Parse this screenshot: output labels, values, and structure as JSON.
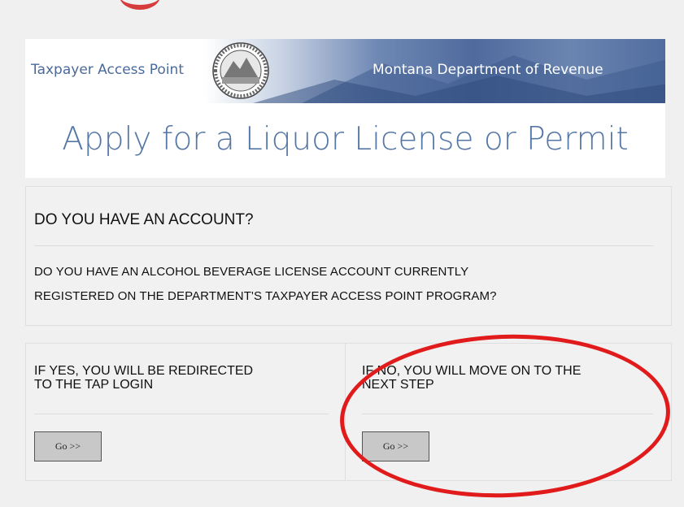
{
  "header": {
    "banner_left": "Taxpayer Access Point",
    "banner_right": "Montana Department of Revenue",
    "title": "Apply for a Liquor License or Permit"
  },
  "question": {
    "heading": "DO YOU HAVE AN ACCOUNT?",
    "line1": "DO YOU HAVE AN ALCOHOL BEVERAGE LICENSE ACCOUNT CURRENTLY",
    "line2": "REGISTERED ON THE DEPARTMENT'S TAXPAYER ACCESS POINT PROGRAM?"
  },
  "yes_option": {
    "line1": "IF YES, YOU WILL BE REDIRECTED",
    "line2": "TO THE TAP LOGIN",
    "button": "Go >>"
  },
  "no_option": {
    "line1": "IF NO, YOU WILL MOVE ON TO THE",
    "line2": "NEXT STEP",
    "button": "Go >>"
  },
  "colors": {
    "title": "#5577a5",
    "highlight": "#e11b1b"
  },
  "icons": {
    "seal": "montana-state-seal-icon"
  }
}
